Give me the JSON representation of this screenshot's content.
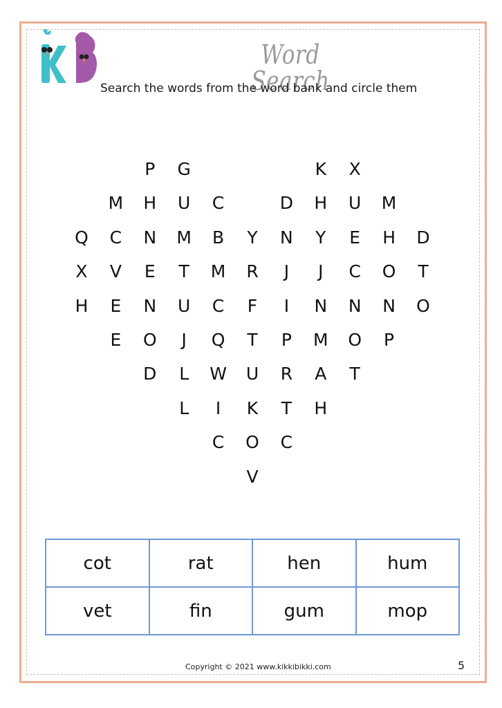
{
  "header": {
    "logo": "kikkibikki-logo",
    "title": "Word Search",
    "subtitle": "Search the words from the word bank and circle them"
  },
  "puzzle": {
    "shape": "heart",
    "rows": [
      [
        "",
        "",
        "P",
        "G",
        "",
        "",
        "",
        "K",
        "X",
        "",
        ""
      ],
      [
        "",
        "M",
        "H",
        "U",
        "C",
        "",
        "D",
        "H",
        "U",
        "M",
        ""
      ],
      [
        "Q",
        "C",
        "N",
        "M",
        "B",
        "Y",
        "N",
        "Y",
        "E",
        "H",
        "D"
      ],
      [
        "X",
        "V",
        "E",
        "T",
        "M",
        "R",
        "J",
        "J",
        "C",
        "O",
        "T"
      ],
      [
        "H",
        "E",
        "N",
        "U",
        "C",
        "F",
        "I",
        "N",
        "N",
        "N",
        "O"
      ],
      [
        "",
        "E",
        "O",
        "J",
        "Q",
        "T",
        "P",
        "M",
        "O",
        "P",
        ""
      ],
      [
        "",
        "",
        "D",
        "L",
        "W",
        "U",
        "R",
        "A",
        "T",
        "",
        ""
      ],
      [
        "",
        "",
        "",
        "L",
        "I",
        "K",
        "T",
        "H",
        "",
        "",
        ""
      ],
      [
        "",
        "",
        "",
        "",
        "C",
        "O",
        "C",
        "",
        "",
        "",
        ""
      ],
      [
        "",
        "",
        "",
        "",
        "",
        "V",
        "",
        "",
        "",
        "",
        ""
      ]
    ]
  },
  "word_bank": {
    "rows": [
      [
        "cot",
        "rat",
        "hen",
        "hum"
      ],
      [
        "vet",
        "fin",
        "gum",
        "mop"
      ]
    ]
  },
  "footer": {
    "copyright": "Copyright © 2021 www.kikkibikki.com",
    "page_number": "5"
  },
  "colors": {
    "frame": "#eeab8f",
    "table_border": "#6f97d9",
    "logo_k": "#3fbfc9",
    "logo_b": "#a45aa8",
    "title": "#9a9a9a"
  }
}
